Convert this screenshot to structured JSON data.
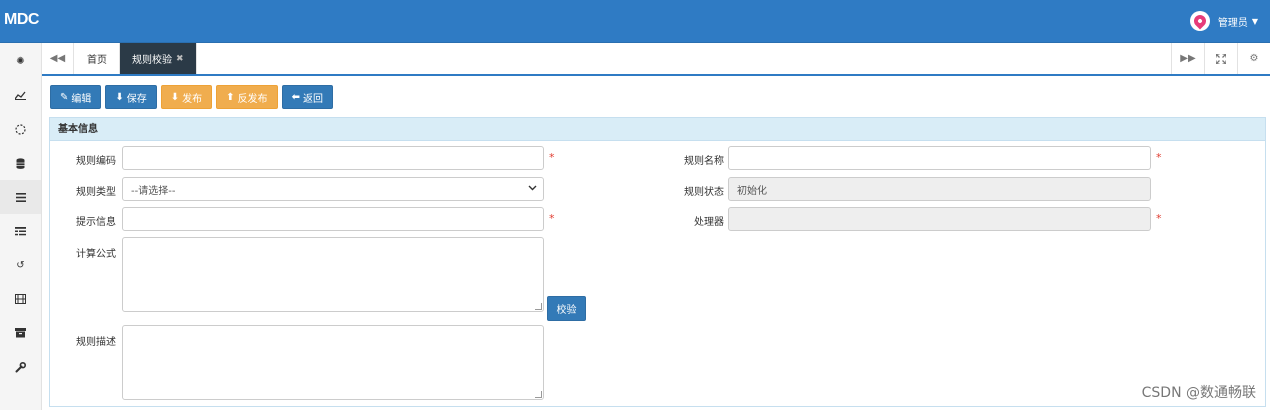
{
  "app": {
    "brand": "MDC",
    "user_name": "管理员"
  },
  "tabs": [
    {
      "label": "首页",
      "active": false
    },
    {
      "label": "规则校验",
      "active": true
    }
  ],
  "toolbar": {
    "edit_label": "编辑",
    "save_label": "保存",
    "publish_label": "发布",
    "unpublish_label": "反发布",
    "back_label": "返回"
  },
  "panel": {
    "title": "基本信息"
  },
  "form": {
    "rule_code_label": "规则编码",
    "rule_code_value": "",
    "rule_name_label": "规则名称",
    "rule_name_value": "",
    "rule_type_label": "规则类型",
    "rule_type_selected": "--请选择--",
    "rule_status_label": "规则状态",
    "rule_status_value": "初始化",
    "hint_label": "提示信息",
    "hint_value": "",
    "processor_label": "处理器",
    "processor_value": "",
    "formula_label": "计算公式",
    "formula_value": "",
    "check_button_label": "校验",
    "description_label": "规则描述",
    "description_value": "",
    "required_mark": "*"
  },
  "watermark": "CSDN @数通畅联",
  "colors": {
    "header": "#2f7bc4",
    "primary": "#337ab7",
    "warning": "#f0ad4e",
    "panel_head": "#d9edf7",
    "required": "#e03c31"
  },
  "sidebar_icons": [
    "cube-icon",
    "line-chart-icon",
    "spinner-icon",
    "database-icon",
    "list-icon",
    "table-list-icon",
    "history-icon",
    "film-icon",
    "archive-icon",
    "wrench-icon"
  ]
}
